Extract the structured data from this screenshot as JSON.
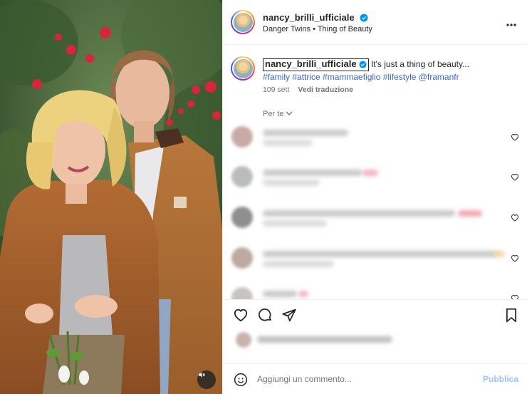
{
  "post": {
    "username": "nancy_brilli_ufficiale",
    "audio": "Danger Twins • Thing of Beauty",
    "more_label": "•••"
  },
  "caption": {
    "username": "nancy_brilli_ufficiale",
    "text": "It's just a thing of beauty...",
    "hashtags": "#family #attrice #mammaefiglio #lifestyle @framanfr",
    "time": "109 sett",
    "translate_label": "Vedi traduzione"
  },
  "comments": {
    "filter_label": "Per te"
  },
  "composer": {
    "placeholder": "Aggiungi un commento...",
    "publish_label": "Pubblica"
  },
  "colors": {
    "accent": "#0095f6",
    "link": "#3f67c9",
    "verified": "#0095f6"
  },
  "icons": {
    "header": [
      "verified-icon",
      "more-icon"
    ],
    "actions": [
      "heart-icon",
      "comment-icon",
      "share-icon",
      "bookmark-icon"
    ],
    "composer": [
      "emoji-icon"
    ],
    "photo": [
      "mute-icon"
    ]
  }
}
